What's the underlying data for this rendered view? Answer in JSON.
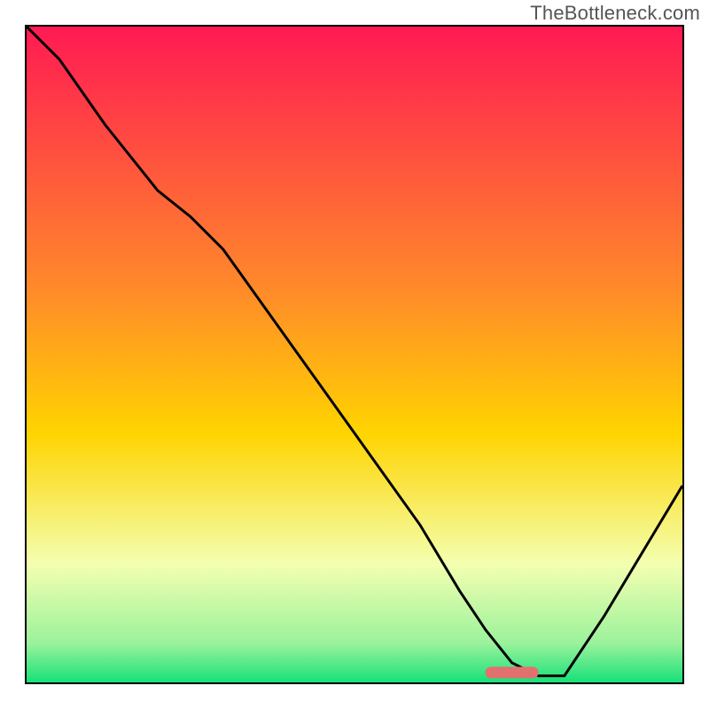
{
  "watermark": "TheBottleneck.com",
  "colors": {
    "gradient_top": "#ff1a53",
    "gradient_mid": "#ffd400",
    "gradient_low": "#f5ffbc",
    "gradient_bottom": "#16e178",
    "curve": "#000000",
    "marker": "#e2706f",
    "border": "#000000"
  },
  "chart_data": {
    "type": "line",
    "title": "",
    "xlabel": "",
    "ylabel": "",
    "xlim": [
      0,
      100
    ],
    "ylim": [
      0,
      100
    ],
    "x": [
      0,
      5,
      12,
      20,
      25,
      30,
      40,
      50,
      60,
      66,
      70,
      74,
      78,
      82,
      88,
      94,
      100
    ],
    "values": [
      100,
      95,
      85,
      75,
      71,
      66,
      52,
      38,
      24,
      14,
      8,
      3,
      1,
      1,
      10,
      20,
      30
    ],
    "marker": {
      "x_start": 70,
      "x_end": 78,
      "y": 1.5
    },
    "gradient_stops": [
      {
        "offset": 0.0,
        "color": "#ff1a53"
      },
      {
        "offset": 0.4,
        "color": "#ff8a2a"
      },
      {
        "offset": 0.62,
        "color": "#ffd400"
      },
      {
        "offset": 0.82,
        "color": "#f3ffb0"
      },
      {
        "offset": 0.94,
        "color": "#9cf29c"
      },
      {
        "offset": 1.0,
        "color": "#16e178"
      }
    ]
  }
}
